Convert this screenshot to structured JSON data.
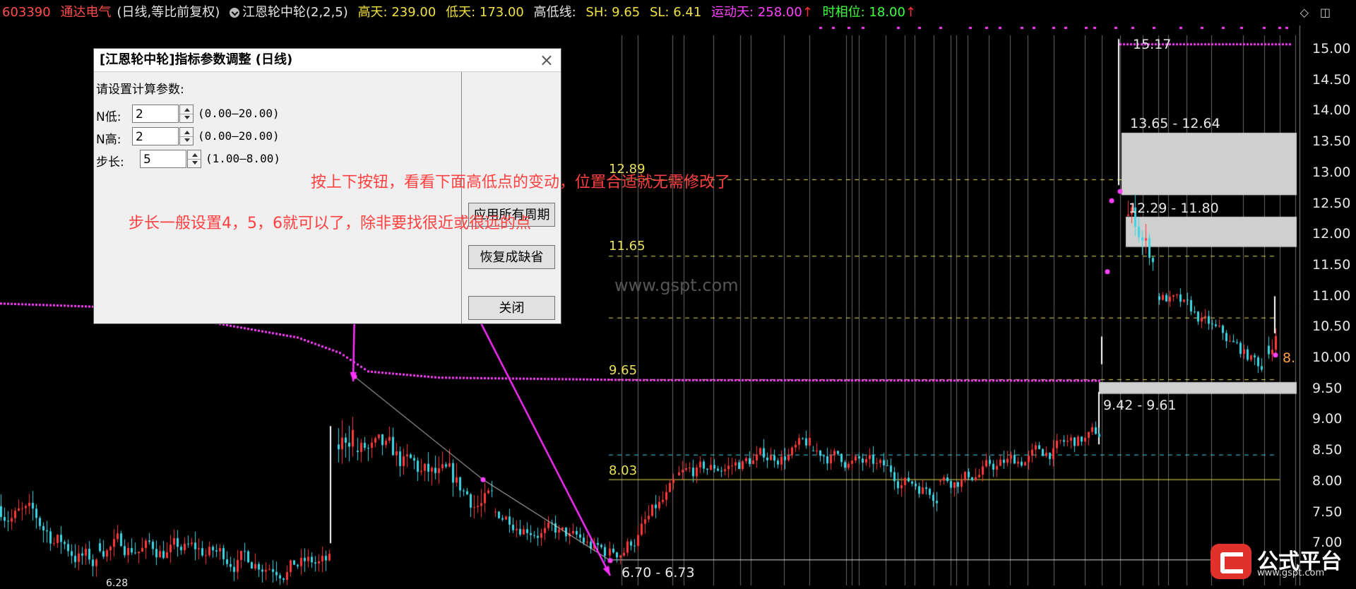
{
  "topbar": {
    "code": "603390",
    "name": "通达电气",
    "mode": "(日线,等比前复权)",
    "indicator": "江恩轮中轮(2,2,5)",
    "high_days": "高天: 239.00",
    "low_days": "低天: 173.00",
    "hl_line": "高低线:",
    "sh": "SH: 9.65",
    "sl": "SL: 6.41",
    "move_days": "运动天: 258.00",
    "time_phase": "时相位: 18.00",
    "arrow": "↑",
    "icons": [
      "diamond-icon",
      "window-icon"
    ]
  },
  "price_axis": [
    "15.00",
    "14.50",
    "14.00",
    "13.50",
    "13.00",
    "12.50",
    "12.00",
    "11.50",
    "11.00",
    "10.50",
    "10.00",
    "9.50",
    "9.00",
    "8.50",
    "8.00",
    "7.50",
    "7.00"
  ],
  "dialog": {
    "title": "[江恩轮中轮]指标参数调整 (日线)",
    "close": "×",
    "prompt": "请设置计算参数:",
    "params": [
      {
        "label": "N低:",
        "value": "2",
        "range": "(0.00—20.00)"
      },
      {
        "label": "N高:",
        "value": "2",
        "range": "(0.00—20.00)"
      },
      {
        "label": "步长:",
        "value": "5",
        "range": "(1.00—8.00)"
      }
    ],
    "buttons": {
      "apply_all": "应用所有周期",
      "restore": "恢复成缺省",
      "close": "关闭"
    }
  },
  "annotations": {
    "hint1": "按上下按钮，看看下面高低点的变动，位置合适就无需修改了",
    "hint2": "步长一般设置4，5，6就可以了，除非要找很近或很远的点"
  },
  "chart_labels": {
    "level_1289": "12.89",
    "level_1165": "11.65",
    "level_965": "9.65",
    "level_803": "8.03",
    "range_top": "15.17",
    "range_1365": "13.65 - 12.64",
    "range_1229": "12.29 - 11.80",
    "range_942": "9.42 - 9.61",
    "range_670": "6.70 - 6.73",
    "edge_8": "8.",
    "bottom_left": "6.28",
    "watermark": "www.gspt.com"
  },
  "logo": {
    "text": "公式平台",
    "url": "www.gspt.com"
  },
  "colors": {
    "up": "#ff3a3a",
    "down": "#3ed6e6",
    "magenta": "#ff40ff",
    "annot": "#ff4040",
    "level": "#e8e05a",
    "box": "#cfcfcf"
  }
}
